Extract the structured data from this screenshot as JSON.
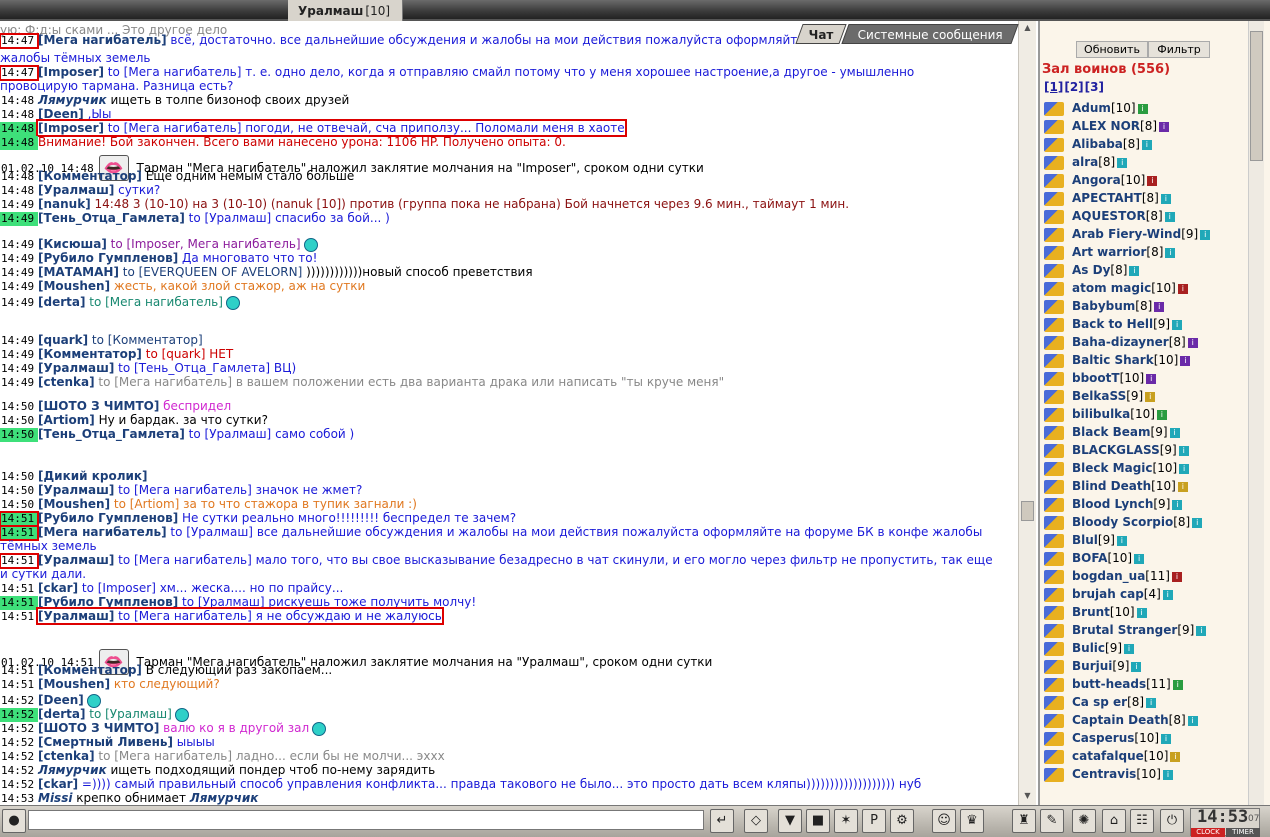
{
  "window": {
    "title": "Уралмаш",
    "level": "[10]"
  },
  "tabs": {
    "chat": "Чат",
    "system": "Системные сообщения"
  },
  "chat": [
    {
      "t": "",
      "text": "ую: Ф:д:ы сками ... Это другое дело",
      "cls": "grey"
    },
    {
      "t": "14:47",
      "box": true,
      "nick": "[Мега нагибатель]",
      "text": " всё, достаточно. все дальнейшие обсуждения и жалобы на мои действия пожалуйста оформляйте",
      "cls": "blue"
    },
    {
      "t": "",
      "text": "жалобы тёмных земель",
      "cls": "blue"
    },
    {
      "t": "14:47",
      "box": true,
      "nick": "[Imposer]",
      "to": " to [Мега нагибатель]",
      "text": " т. е. одно дело, когда я отправляю смайл потому что у меня хорошее настроение,а другое - умышленно",
      "cls": "blue"
    },
    {
      "t": "",
      "text": "провоцирую тармана. Разница есть?",
      "cls": "blue"
    },
    {
      "t": "14:48",
      "nick": "Лямурчик",
      "italic": true,
      "text": " ищеть в толпе бизоноф своих друзей",
      "cls": ""
    },
    {
      "t": "14:48",
      "nick": "[Deen]",
      "text": " ,Ыы",
      "cls": "blue"
    },
    {
      "t": "14:48",
      "green": true,
      "nick": "[Imposer]",
      "to": " to [Мега нагибатель]",
      "text": " погоди, не отвечай, сча приползу... Поломали меня в хаоте",
      "cls": "blue",
      "redline": true
    },
    {
      "t": "14:48",
      "green": true,
      "text": "Внимание! Бой закончен. Всего вами нанесено урона: 1106 HP. Получено опыта: 0.",
      "cls": "red"
    },
    {
      "t": "01.02.10 14:48",
      "icon": "👄",
      "text": " Тарман \"Мега нагибатель\" наложил заклятие молчания на \"Imposer\", сроком одни сутки",
      "cls": ""
    },
    {
      "t": "14:48",
      "nick": "[Комментатор]",
      "text": " Еще одним немым стало больше",
      "cls": ""
    },
    {
      "t": "14:48",
      "nick": "[Уралмаш]",
      "text": " сутки?",
      "cls": "blue"
    },
    {
      "t": "14:49",
      "nick": "[nanuk]",
      "text": " 14:48 3 (10-10) на 3 (10-10) (nanuk [10]) против (группа пока не набрана) Бой начнется через 9.6 мин., таймаут 1 мин.",
      "cls": "maroon"
    },
    {
      "t": "14:49",
      "green": true,
      "nick": "[Тень_Отца_Гамлета]",
      "to": " to [Уралмаш]",
      "text": " спасибо за бой... )",
      "cls": "blue"
    },
    {
      "t": "14:49",
      "nick": "[Кисюша]",
      "to": " to [Imposer, Мега нагибатель]",
      "text": "",
      "cls": "purple",
      "smiley": "cyan"
    },
    {
      "t": "14:49",
      "nick": "[Рубило Гумпленов]",
      "text": " Да многовато что то!",
      "cls": "blue"
    },
    {
      "t": "14:49",
      "nick": "[МАТАМАН]",
      "to": " to [EVERQUEEN OF AVELORN]",
      "text": " ))))))))))))новый способ преветствия",
      "cls": ""
    },
    {
      "t": "14:49",
      "nick": "[Moushen]",
      "text": " жесть, какой злой стажор, аж на сутки",
      "cls": "orange"
    },
    {
      "t": "14:49",
      "nick": "[derta]",
      "to": " to [Мега нагибатель]",
      "text": "",
      "cls": "teal",
      "smiley": "cyan"
    },
    {
      "t": "14:49",
      "nick": "[quark]",
      "to": " to [Комментатор]",
      "text": "",
      "cls": ""
    },
    {
      "t": "14:49",
      "nick": "[Комментатор]",
      "to": " to [quark]",
      "text": " НЕТ",
      "cls": "red"
    },
    {
      "t": "14:49",
      "nick": "[Уралмаш]",
      "to": " to [Тень_Отца_Гамлета]",
      "text": " ВЦ)",
      "cls": "blue"
    },
    {
      "t": "14:49",
      "nick": "[ctenka]",
      "to": " to [Мега нагибатель]",
      "text": " в вашем положении есть два варианта драка или написать \"ты круче меня\"",
      "cls": "grey"
    },
    {
      "t": "14:50",
      "nick": "[ШОТО З ЧИМТО]",
      "text": " беспридел",
      "cls": "magenta"
    },
    {
      "t": "14:50",
      "nick": "[Artiom]",
      "text": " Ну и бардак. за что сутки?",
      "cls": ""
    },
    {
      "t": "14:50",
      "green": true,
      "nick": "[Тень_Отца_Гамлета]",
      "to": " to [Уралмаш]",
      "text": " само собой )",
      "cls": "blue"
    },
    {
      "t": "14:50",
      "nick": "[Дикий кролик]",
      "text": "",
      "cls": ""
    },
    {
      "t": "14:50",
      "nick": "[Уралмаш]",
      "to": " to [Мега нагибатель]",
      "text": " значок не жмет?",
      "cls": "blue"
    },
    {
      "t": "14:50",
      "nick": "[Moushen]",
      "to": " to [Artiom]",
      "text": " за то что стажора в тупик загнали :)",
      "cls": "orange"
    },
    {
      "t": "14:51",
      "green": true,
      "box": true,
      "nick": "[Рубило Гумпленов]",
      "text": " Не сутки реально много!!!!!!!!! беспредел те зачем?",
      "cls": "blue"
    },
    {
      "t": "14:51",
      "green": true,
      "box": true,
      "nick": "[Мега нагибатель]",
      "to": " to [Уралмаш]",
      "text": " все дальнейшие обсуждения и жалобы на мои действия пожалуйста оформляйте на форуме БК в конфе жалобы",
      "cls": "blue"
    },
    {
      "t": "",
      "text": "тёмных земель",
      "cls": "blue"
    },
    {
      "t": "14:51",
      "box": true,
      "nick": "[Уралмаш]",
      "to": " to [Мега нагибатель]",
      "text": " мало того, что вы свое высказывание безадресно в чат скинули, и его могло через фильтр не пропустить, так еще",
      "cls": "blue"
    },
    {
      "t": "",
      "text": "и сутки дали.",
      "cls": "blue"
    },
    {
      "t": "14:51",
      "nick": "[ckar]",
      "to": " to [Imposer]",
      "text": " хм... жеска.... но по прайсу...",
      "cls": "blue"
    },
    {
      "t": "14:51",
      "green": true,
      "nick": "[Рубило Гумпленов]",
      "to": " to [Уралмаш]",
      "text": " рискуешь тоже получить молчу!",
      "cls": "blue"
    },
    {
      "t": "14:51",
      "nick": "[Уралмаш]",
      "to": " to [Мега нагибатель]",
      "text": " я не обсуждаю и не жалуюсь",
      "cls": "blue",
      "redline": true
    },
    {
      "t": "01.02.10 14:51",
      "icon": "👄",
      "text": " Тарман \"Мега нагибатель\" наложил заклятие молчания на \"Уралмаш\", сроком одни сутки",
      "cls": ""
    },
    {
      "t": "14:51",
      "nick": "[Комментатор]",
      "text": " В следующий раз закопаем...",
      "cls": ""
    },
    {
      "t": "14:51",
      "nick": "[Moushen]",
      "text": " кто следующий?",
      "cls": "orange"
    },
    {
      "t": "14:52",
      "nick": "[Deen]",
      "text": "",
      "cls": "blue",
      "smiley": "cyan"
    },
    {
      "t": "14:52",
      "green": true,
      "nick": "[derta]",
      "to": " to [Уралмаш]",
      "text": "",
      "cls": "teal",
      "smiley": "cyan"
    },
    {
      "t": "14:52",
      "nick": "[ШОТО З ЧИМТО]",
      "text": " валю ко я в другой зал",
      "cls": "magenta",
      "smiley": "cyan"
    },
    {
      "t": "14:52",
      "nick": "[Смертный Ливень]",
      "text": " ыыыы",
      "cls": "blue"
    },
    {
      "t": "14:52",
      "nick": "[ctenka]",
      "to": " to [Мега нагибатель]",
      "text": " ладно... если бы не молчи... эххх",
      "cls": "grey"
    },
    {
      "t": "14:52",
      "nick": "Лямурчик",
      "italic": true,
      "text": " ищеть подходящий пондер чтоб по-нему зарядить",
      "cls": ""
    },
    {
      "t": "14:52",
      "nick": "[ckar]",
      "text": " =)))) самый правильный способ управления конфликта... правда такового не было... это просто дать всем кляпы))))))))))))))))))) нуб",
      "cls": "blue"
    },
    {
      "t": "14:53",
      "nick": "Missi",
      "italic": true,
      "text": " крепко обнимает Лямурчик",
      "cls": "",
      "tailbold": true
    }
  ],
  "right": {
    "refresh": "Обновить",
    "filter": "Фильтр",
    "hall": "Зал воинов (556)",
    "pages": [
      "[1]",
      "[2]",
      "[3]"
    ],
    "players": [
      {
        "n": "Adum",
        "l": "[10]",
        "i": "green"
      },
      {
        "n": "ALEX NOR",
        "l": "[8]",
        "i": "purple"
      },
      {
        "n": "Alibaba",
        "l": "[8]",
        "i": "teal"
      },
      {
        "n": "alra",
        "l": "[8]",
        "i": "teal"
      },
      {
        "n": "Angora",
        "l": "[10]",
        "i": "red"
      },
      {
        "n": "APECTAHT",
        "l": "[8]",
        "i": "teal"
      },
      {
        "n": "AQUESTOR",
        "l": "[8]",
        "i": "teal"
      },
      {
        "n": "Arab Fiery-Wind",
        "l": "[9]",
        "i": "teal"
      },
      {
        "n": "Art warrior",
        "l": "[8]",
        "i": "teal"
      },
      {
        "n": "As Dy",
        "l": "[8]",
        "i": "teal"
      },
      {
        "n": "atom magic",
        "l": "[10]",
        "i": "red"
      },
      {
        "n": "Babybum",
        "l": "[8]",
        "i": "purple"
      },
      {
        "n": "Back to Hell",
        "l": "[9]",
        "i": "teal"
      },
      {
        "n": "Baha-dizayner",
        "l": "[8]",
        "i": "purple"
      },
      {
        "n": "Baltic Shark",
        "l": "[10]",
        "i": "purple"
      },
      {
        "n": "bbootT",
        "l": "[10]",
        "i": "purple"
      },
      {
        "n": "BelkaSS",
        "l": "[9]",
        "i": "gold"
      },
      {
        "n": "bilibulka",
        "l": "[10]",
        "i": "green"
      },
      {
        "n": "Black Beam",
        "l": "[9]",
        "i": "teal"
      },
      {
        "n": "BLACKGLASS",
        "l": "[9]",
        "i": "teal"
      },
      {
        "n": "Bleck Magic",
        "l": "[10]",
        "i": "teal"
      },
      {
        "n": "Blind Death",
        "l": "[10]",
        "i": "gold"
      },
      {
        "n": "Blood Lynch",
        "l": "[9]",
        "i": "teal"
      },
      {
        "n": "Bloody Scorpio",
        "l": "[8]",
        "i": "teal"
      },
      {
        "n": "Blul",
        "l": "[9]",
        "i": "teal"
      },
      {
        "n": "BOFA",
        "l": "[10]",
        "i": "teal"
      },
      {
        "n": "bogdan_ua",
        "l": "[11]",
        "i": "red"
      },
      {
        "n": "brujah cap",
        "l": "[4]",
        "i": "teal"
      },
      {
        "n": "Brunt",
        "l": "[10]",
        "i": "teal"
      },
      {
        "n": "Brutal Stranger",
        "l": "[9]",
        "i": "teal"
      },
      {
        "n": "Bulic",
        "l": "[9]",
        "i": "teal"
      },
      {
        "n": "Burjui",
        "l": "[9]",
        "i": "teal"
      },
      {
        "n": "butt-heads",
        "l": "[11]",
        "i": "green"
      },
      {
        "n": "Ca sp er",
        "l": "[8]",
        "i": "teal"
      },
      {
        "n": "Captain Death",
        "l": "[8]",
        "i": "teal"
      },
      {
        "n": "Casperus",
        "l": "[10]",
        "i": "teal"
      },
      {
        "n": "catafalque",
        "l": "[10]",
        "i": "gold"
      },
      {
        "n": "Centravis",
        "l": "[10]",
        "i": "teal"
      }
    ]
  },
  "bottom": {
    "input_value": "",
    "clock": "14:53",
    "seconds": "07",
    "clock_label": "CLOCK",
    "timer_label": "TIMER"
  }
}
